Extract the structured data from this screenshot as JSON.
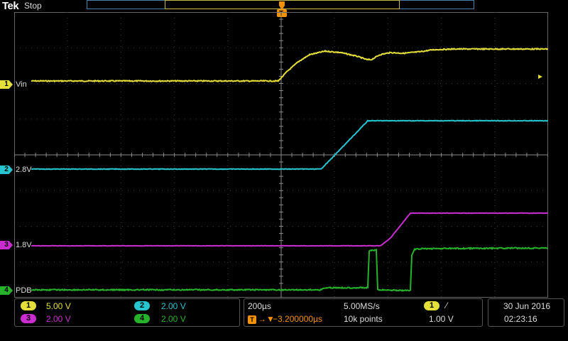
{
  "header": {
    "brand": "Tek",
    "acq_state": "Stop",
    "trigger_marker": "T"
  },
  "colors": {
    "ch1": "#e5e039",
    "ch2": "#27c5d0",
    "ch3": "#c92ccf",
    "ch4": "#26b32b",
    "trigger": "#f39200"
  },
  "channels": [
    {
      "id": "ch1",
      "number": "1",
      "label": "Vin",
      "scale": "5.00 V"
    },
    {
      "id": "ch2",
      "number": "2",
      "label": "2.8V",
      "scale": "2.00 V"
    },
    {
      "id": "ch3",
      "number": "3",
      "label": "1.8V",
      "scale": "2.00 V"
    },
    {
      "id": "ch4",
      "number": "4",
      "label": "PDB",
      "scale": "2.00 V"
    }
  ],
  "horizontal": {
    "scale": "200µs",
    "sample_rate": "5.00MS/s",
    "position": "−3.200000µs",
    "record_length": "10k points"
  },
  "trigger": {
    "source": "1",
    "slope_icon": "rising-edge-icon",
    "slope": "⁄",
    "level": "1.00 V"
  },
  "datetime": {
    "date": "30 Jun  2016",
    "time": "02:23:16"
  }
}
